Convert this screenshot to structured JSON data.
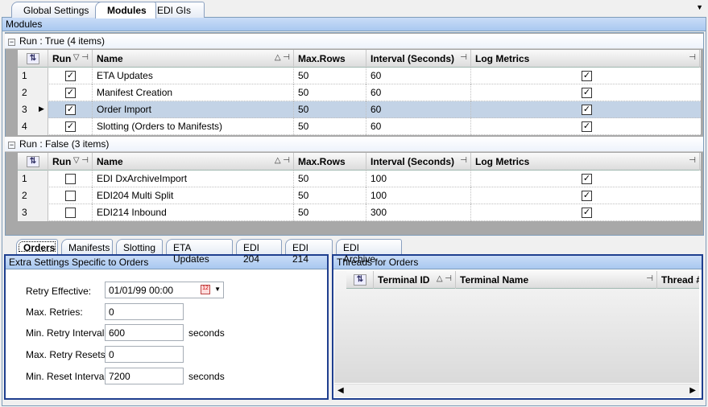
{
  "top_tabs": [
    "Global Settings",
    "Modules",
    "EDI GIs"
  ],
  "active_top_tab": 1,
  "modules_panel_title": "Modules",
  "columns": [
    "Run",
    "Name",
    "Max.Rows",
    "Interval (Seconds)",
    "Log Metrics"
  ],
  "groups": [
    {
      "label": "Run : True (4 items)",
      "rows": [
        {
          "idx": "1",
          "run": true,
          "name": "ETA Updates",
          "max_rows": "50",
          "interval": "60",
          "log": true
        },
        {
          "idx": "2",
          "run": true,
          "name": "Manifest Creation",
          "max_rows": "50",
          "interval": "60",
          "log": true
        },
        {
          "idx": "3",
          "run": true,
          "name": "Order Import",
          "max_rows": "50",
          "interval": "60",
          "log": true,
          "selected": true
        },
        {
          "idx": "4",
          "run": true,
          "name": "Slotting (Orders to Manifests)",
          "max_rows": "50",
          "interval": "60",
          "log": true
        }
      ]
    },
    {
      "label": "Run : False (3 items)",
      "rows": [
        {
          "idx": "1",
          "run": false,
          "name": "EDI DxArchiveImport",
          "max_rows": "50",
          "interval": "100",
          "log": true
        },
        {
          "idx": "2",
          "run": false,
          "name": "EDI204 Multi Split",
          "max_rows": "50",
          "interval": "100",
          "log": true
        },
        {
          "idx": "3",
          "run": false,
          "name": "EDI214 Inbound",
          "max_rows": "50",
          "interval": "300",
          "log": true
        }
      ]
    }
  ],
  "bottom_tabs": [
    "Orders",
    "Manifests",
    "Slotting",
    "ETA Updates",
    "EDI 204",
    "EDI 214",
    "EDI Archive"
  ],
  "extra_settings": {
    "title": "Extra Settings Specific to Orders",
    "retry_effective_label": "Retry Effective:",
    "retry_effective": "01/01/99 00:00",
    "max_retries_label": "Max. Retries:",
    "max_retries": "0",
    "min_retry_interval_label": "Min. Retry Interval:",
    "min_retry_interval": "600",
    "max_retry_resets_label": "Max. Retry Resets:",
    "max_retry_resets": "0",
    "min_reset_interval_label": "Min. Reset Interval:",
    "min_reset_interval": "7200",
    "seconds": "seconds"
  },
  "threads": {
    "title": "Threads for Orders",
    "columns": [
      "Terminal ID",
      "Terminal Name",
      "Thread #"
    ]
  }
}
